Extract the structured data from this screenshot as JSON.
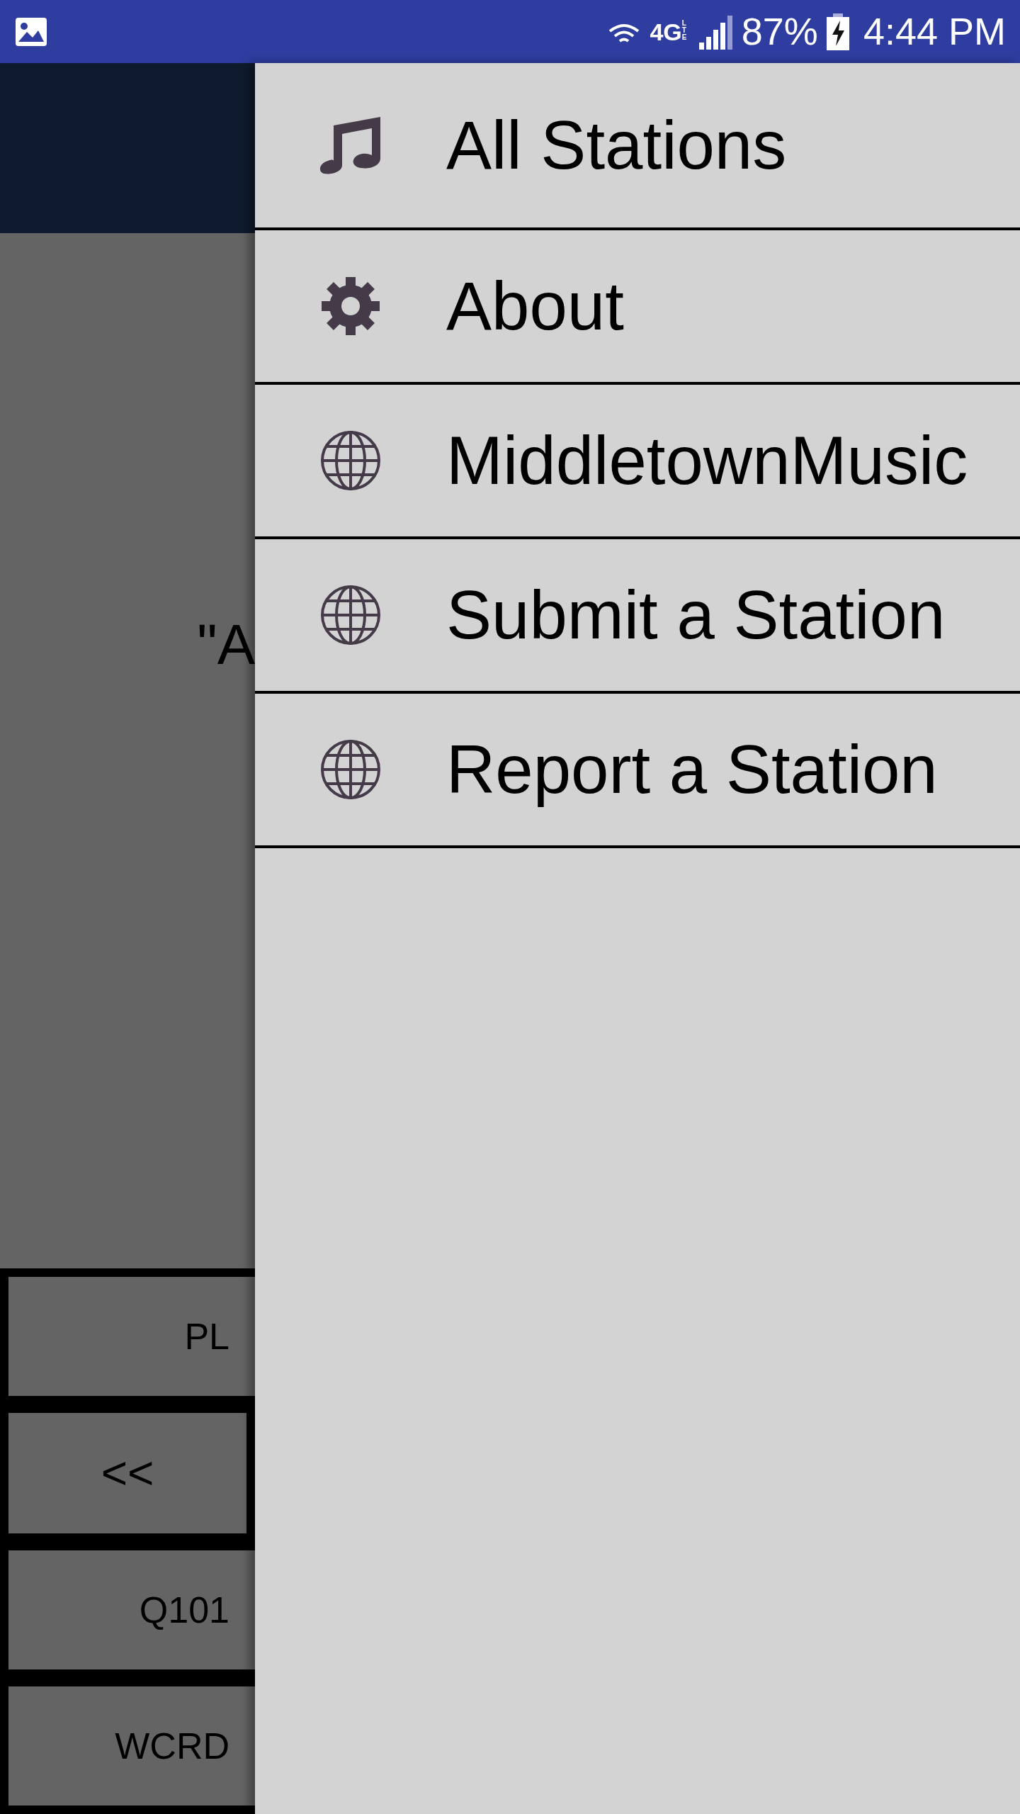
{
  "status_bar": {
    "network": "4G",
    "network_sub": "LTE",
    "battery": "87%",
    "time": "4:44 PM"
  },
  "background": {
    "quote": "\"A",
    "buttons": [
      {
        "label": "PL",
        "kind": "clipped"
      },
      {
        "label": "<<",
        "kind": "boxed"
      },
      {
        "label": "Q101",
        "kind": "clipped"
      },
      {
        "label": "WCRD",
        "kind": "clipped"
      }
    ]
  },
  "drawer": {
    "items": [
      {
        "label": "All Stations",
        "kind": "music"
      },
      {
        "label": "About",
        "kind": "gear"
      },
      {
        "label": "MiddletownMusic",
        "kind": "globe"
      },
      {
        "label": "Submit a Station",
        "kind": "globe"
      },
      {
        "label": "Report a Station",
        "kind": "globe"
      }
    ]
  }
}
